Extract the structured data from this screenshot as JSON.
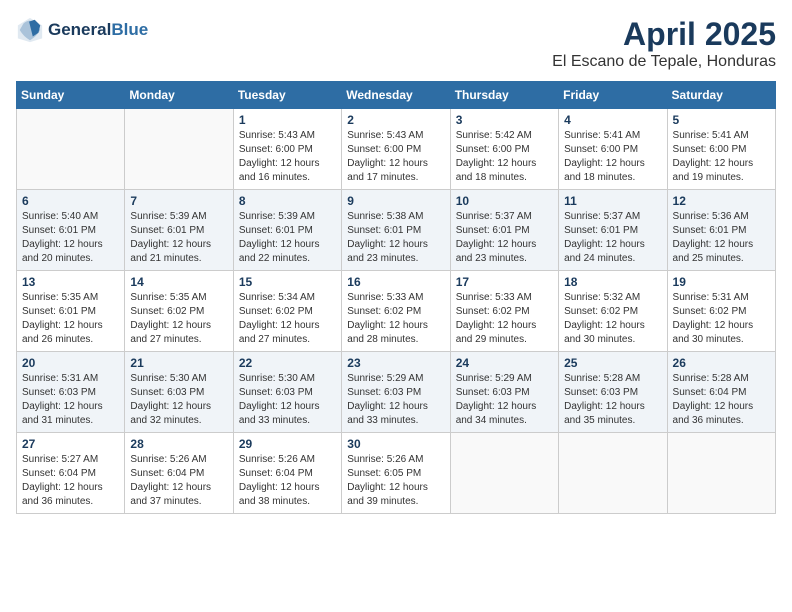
{
  "header": {
    "logo_line1": "General",
    "logo_line2": "Blue",
    "month": "April 2025",
    "location": "El Escano de Tepale, Honduras"
  },
  "weekdays": [
    "Sunday",
    "Monday",
    "Tuesday",
    "Wednesday",
    "Thursday",
    "Friday",
    "Saturday"
  ],
  "weeks": [
    [
      {
        "day": "",
        "empty": true
      },
      {
        "day": "",
        "empty": true
      },
      {
        "day": "1",
        "sunrise": "5:43 AM",
        "sunset": "6:00 PM",
        "daylight": "12 hours and 16 minutes."
      },
      {
        "day": "2",
        "sunrise": "5:43 AM",
        "sunset": "6:00 PM",
        "daylight": "12 hours and 17 minutes."
      },
      {
        "day": "3",
        "sunrise": "5:42 AM",
        "sunset": "6:00 PM",
        "daylight": "12 hours and 18 minutes."
      },
      {
        "day": "4",
        "sunrise": "5:41 AM",
        "sunset": "6:00 PM",
        "daylight": "12 hours and 18 minutes."
      },
      {
        "day": "5",
        "sunrise": "5:41 AM",
        "sunset": "6:00 PM",
        "daylight": "12 hours and 19 minutes."
      }
    ],
    [
      {
        "day": "6",
        "sunrise": "5:40 AM",
        "sunset": "6:01 PM",
        "daylight": "12 hours and 20 minutes."
      },
      {
        "day": "7",
        "sunrise": "5:39 AM",
        "sunset": "6:01 PM",
        "daylight": "12 hours and 21 minutes."
      },
      {
        "day": "8",
        "sunrise": "5:39 AM",
        "sunset": "6:01 PM",
        "daylight": "12 hours and 22 minutes."
      },
      {
        "day": "9",
        "sunrise": "5:38 AM",
        "sunset": "6:01 PM",
        "daylight": "12 hours and 23 minutes."
      },
      {
        "day": "10",
        "sunrise": "5:37 AM",
        "sunset": "6:01 PM",
        "daylight": "12 hours and 23 minutes."
      },
      {
        "day": "11",
        "sunrise": "5:37 AM",
        "sunset": "6:01 PM",
        "daylight": "12 hours and 24 minutes."
      },
      {
        "day": "12",
        "sunrise": "5:36 AM",
        "sunset": "6:01 PM",
        "daylight": "12 hours and 25 minutes."
      }
    ],
    [
      {
        "day": "13",
        "sunrise": "5:35 AM",
        "sunset": "6:01 PM",
        "daylight": "12 hours and 26 minutes."
      },
      {
        "day": "14",
        "sunrise": "5:35 AM",
        "sunset": "6:02 PM",
        "daylight": "12 hours and 27 minutes."
      },
      {
        "day": "15",
        "sunrise": "5:34 AM",
        "sunset": "6:02 PM",
        "daylight": "12 hours and 27 minutes."
      },
      {
        "day": "16",
        "sunrise": "5:33 AM",
        "sunset": "6:02 PM",
        "daylight": "12 hours and 28 minutes."
      },
      {
        "day": "17",
        "sunrise": "5:33 AM",
        "sunset": "6:02 PM",
        "daylight": "12 hours and 29 minutes."
      },
      {
        "day": "18",
        "sunrise": "5:32 AM",
        "sunset": "6:02 PM",
        "daylight": "12 hours and 30 minutes."
      },
      {
        "day": "19",
        "sunrise": "5:31 AM",
        "sunset": "6:02 PM",
        "daylight": "12 hours and 30 minutes."
      }
    ],
    [
      {
        "day": "20",
        "sunrise": "5:31 AM",
        "sunset": "6:03 PM",
        "daylight": "12 hours and 31 minutes."
      },
      {
        "day": "21",
        "sunrise": "5:30 AM",
        "sunset": "6:03 PM",
        "daylight": "12 hours and 32 minutes."
      },
      {
        "day": "22",
        "sunrise": "5:30 AM",
        "sunset": "6:03 PM",
        "daylight": "12 hours and 33 minutes."
      },
      {
        "day": "23",
        "sunrise": "5:29 AM",
        "sunset": "6:03 PM",
        "daylight": "12 hours and 33 minutes."
      },
      {
        "day": "24",
        "sunrise": "5:29 AM",
        "sunset": "6:03 PM",
        "daylight": "12 hours and 34 minutes."
      },
      {
        "day": "25",
        "sunrise": "5:28 AM",
        "sunset": "6:03 PM",
        "daylight": "12 hours and 35 minutes."
      },
      {
        "day": "26",
        "sunrise": "5:28 AM",
        "sunset": "6:04 PM",
        "daylight": "12 hours and 36 minutes."
      }
    ],
    [
      {
        "day": "27",
        "sunrise": "5:27 AM",
        "sunset": "6:04 PM",
        "daylight": "12 hours and 36 minutes."
      },
      {
        "day": "28",
        "sunrise": "5:26 AM",
        "sunset": "6:04 PM",
        "daylight": "12 hours and 37 minutes."
      },
      {
        "day": "29",
        "sunrise": "5:26 AM",
        "sunset": "6:04 PM",
        "daylight": "12 hours and 38 minutes."
      },
      {
        "day": "30",
        "sunrise": "5:26 AM",
        "sunset": "6:05 PM",
        "daylight": "12 hours and 39 minutes."
      },
      {
        "day": "",
        "empty": true
      },
      {
        "day": "",
        "empty": true
      },
      {
        "day": "",
        "empty": true
      }
    ]
  ],
  "labels": {
    "sunrise": "Sunrise:",
    "sunset": "Sunset:",
    "daylight": "Daylight:"
  },
  "colors": {
    "header_bg": "#2e6da4",
    "title": "#1a3a5c"
  }
}
